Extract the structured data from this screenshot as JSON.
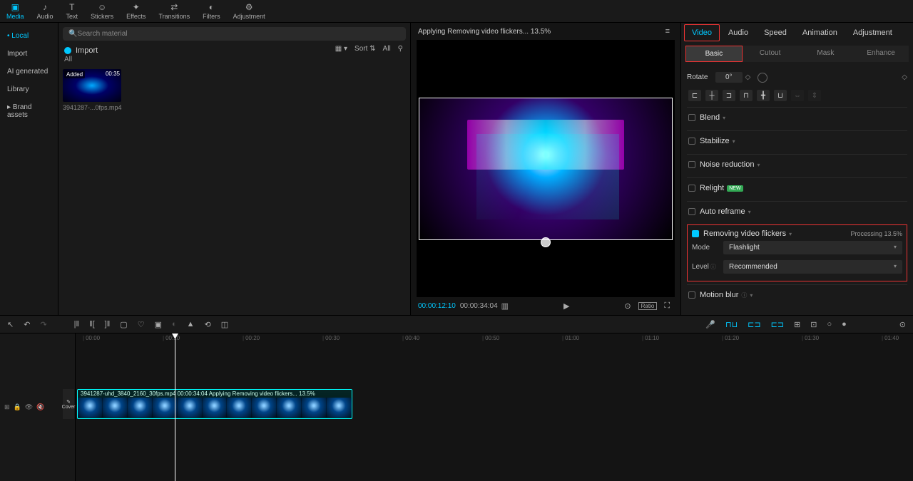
{
  "topTabs": [
    {
      "label": "Media",
      "icon": "▣"
    },
    {
      "label": "Audio",
      "icon": "♪"
    },
    {
      "label": "Text",
      "icon": "T"
    },
    {
      "label": "Stickers",
      "icon": "☺"
    },
    {
      "label": "Effects",
      "icon": "✦"
    },
    {
      "label": "Transitions",
      "icon": "⇄"
    },
    {
      "label": "Filters",
      "icon": "◐"
    },
    {
      "label": "Adjustment",
      "icon": "⚙"
    }
  ],
  "sidebar": {
    "items": [
      "Local",
      "Import",
      "AI generated",
      "Library",
      "Brand assets"
    ]
  },
  "media": {
    "searchPlaceholder": "Search material",
    "importLabel": "Import",
    "sortLabel": "Sort",
    "allLabel": "All",
    "allCategory": "All",
    "thumb": {
      "added": "Added",
      "duration": "00:35",
      "name": "3941287-...0fps.mp4"
    }
  },
  "preview": {
    "title": "Applying Removing video flickers... 13.5%",
    "time": "00:00:12:10",
    "duration": "00:00:34:04",
    "ratioLabel": "Ratio"
  },
  "inspector": {
    "tabs": [
      "Video",
      "Audio",
      "Speed",
      "Animation",
      "Adjustment"
    ],
    "subtabs": [
      "Basic",
      "Cutout",
      "Mask",
      "Enhance"
    ],
    "rotateLabel": "Rotate",
    "rotateValue": "0°",
    "sections": {
      "blend": "Blend",
      "stabilize": "Stabilize",
      "noise": "Noise reduction",
      "relight": "Relight",
      "relightBadge": "NEW",
      "reframe": "Auto reframe",
      "flicker": "Removing video flickers",
      "flickerStatus": "Processing 13.5%",
      "modeLabel": "Mode",
      "modeValue": "Flashlight",
      "levelLabel": "Level",
      "levelValue": "Recommended",
      "motion": "Motion blur"
    }
  },
  "timeline": {
    "ticks": [
      "00:00",
      "00:10",
      "00:20",
      "00:30",
      "00:40",
      "00:50",
      "01:00",
      "01:10",
      "01:20",
      "01:30",
      "01:40"
    ],
    "clipLabel": "3941287-uhd_3840_2160_30fps.mp4   00:00:34:04   Applying Removing video flickers... 13.5%",
    "coverLabel": "Cover"
  }
}
